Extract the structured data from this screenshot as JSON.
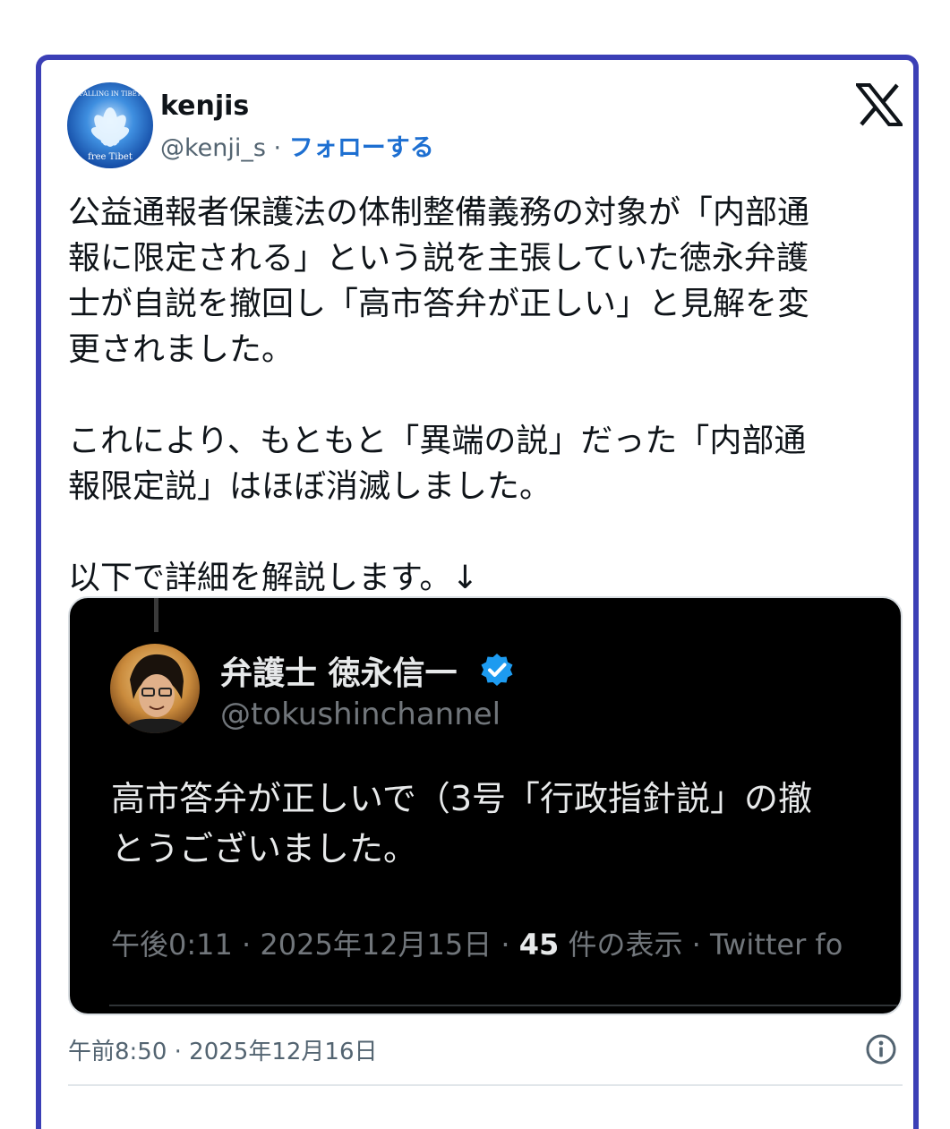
{
  "author": {
    "display_name": "kenjis",
    "handle": "@kenji_s",
    "separator": " · ",
    "follow_label": "フォローする",
    "avatar_caption": "free Tibet",
    "avatar_top_text": "FALLING IN TIBET"
  },
  "tweet": {
    "paragraph1": [
      "公益通報者保護法の体制整備義務の対象が「内部通",
      "報に限定される」という説を主張していた徳永弁護",
      "士が自説を撤回し「高市答弁が正しい」と見解を変",
      "更されました。"
    ],
    "paragraph2": [
      "これにより、もともと「異端の説」だった「内部通",
      "報限定説」はほぼ消滅しました。"
    ],
    "paragraph3": [
      "以下で詳細を解説します。↓"
    ],
    "timestamp": "午前8:50 · 2025年12月16日"
  },
  "embedded": {
    "display_name": "弁護士 徳永信一",
    "handle": "@tokushinchannel",
    "text_lines": [
      "高市答弁が正しいで（3号「行政指針説」の撤",
      "とうございました。"
    ],
    "meta_time": "午後0:11 · 2025年12月15日 · ",
    "meta_views": "45",
    "meta_rest": " 件の表示 · Twitter fo"
  },
  "colors": {
    "card_border": "#3b3fb6",
    "link_blue": "#1d6fd1",
    "verified_blue": "#1d9bf0"
  },
  "icons": {
    "brand": "x-logo-icon",
    "verified": "verified-badge-icon",
    "info": "info-icon"
  }
}
